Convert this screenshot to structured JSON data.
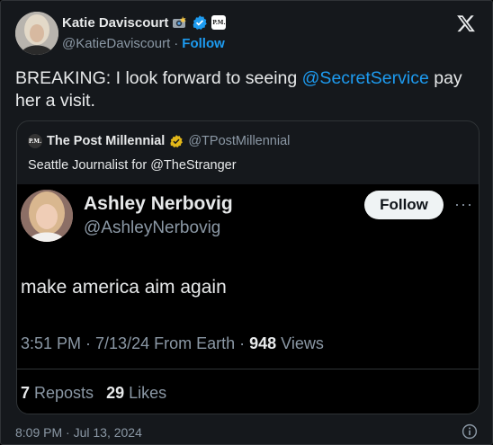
{
  "author": {
    "name": "Katie Daviscourt",
    "handle": "@KatieDaviscourt",
    "separator": "·",
    "follow_label": "Follow",
    "affiliate_badge": "P.M."
  },
  "tweet": {
    "text_before": "BREAKING: I look forward to seeing ",
    "mention": "@SecretService",
    "text_after": " pay her a visit.",
    "timestamp": "8:09 PM · Jul 13, 2024"
  },
  "quote": {
    "logo_text": "P.M.",
    "name": "The Post Millennial",
    "handle": "@TPostMillennial",
    "text": "Seattle Journalist for @TheStranger",
    "screenshot": {
      "name": "Ashley Nerbovig",
      "handle": "@AshleyNerbovig",
      "follow_label": "Follow",
      "more": "···",
      "text": "make america aim again",
      "meta_prefix": "3:51 PM · 7/13/24 From Earth · ",
      "views_count": "948",
      "views_label": " Views",
      "reposts_count": "7",
      "reposts_label": "Reposts",
      "likes_count": "29",
      "likes_label": "Likes"
    }
  },
  "colors": {
    "background": "#15181c",
    "accent": "#1d9bf0",
    "muted": "#8b98a5",
    "gold_check": "#e2b719"
  },
  "icons": [
    "x-logo-icon",
    "verified-blue-icon",
    "verified-gold-icon",
    "info-icon",
    "camera-emoji-icon"
  ]
}
